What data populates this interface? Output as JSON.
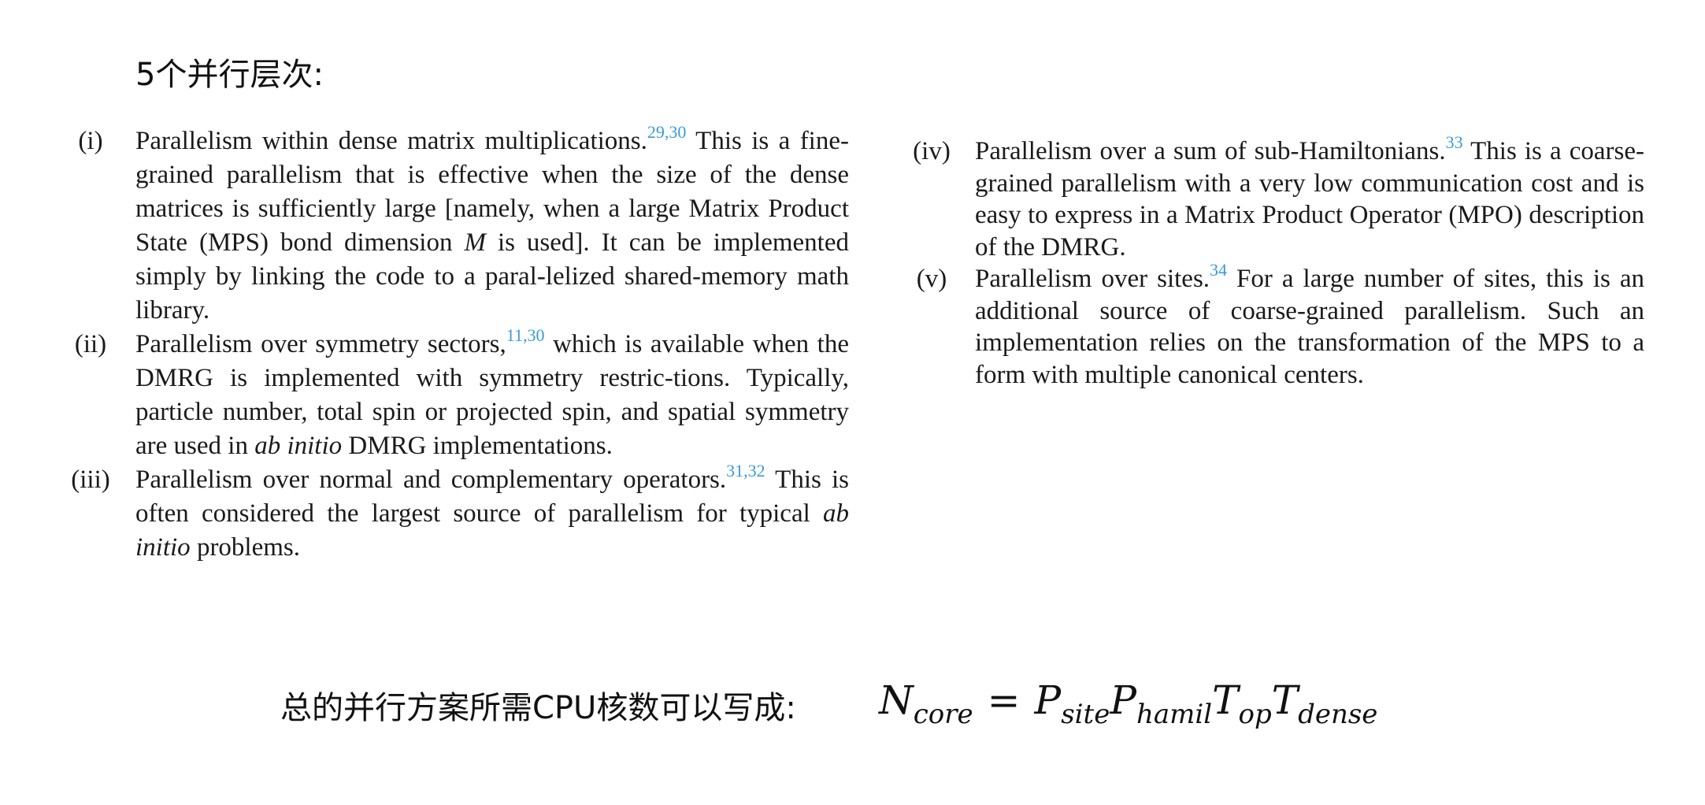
{
  "heading": "5个并行层次:",
  "left_items": [
    {
      "num": "(i)",
      "segments": [
        {
          "t": "Parallelism within dense matrix multiplications."
        },
        {
          "t": "29,30",
          "ref": true
        },
        {
          "t": " This is a fine-grained parallelism that is effective when the size of the dense matrices is sufficiently large [namely, when a large Matrix Product State (MPS) bond dimension "
        },
        {
          "t": "M",
          "it": true
        },
        {
          "t": " is used]. It can be implemented simply by linking the code to a paral-lelized shared-memory math library."
        }
      ]
    },
    {
      "num": "(ii)",
      "segments": [
        {
          "t": "Parallelism over symmetry sectors,"
        },
        {
          "t": "11,30",
          "ref": true
        },
        {
          "t": " which is available when the DMRG is implemented with symmetry restric-tions. Typically, particle number, total spin or projected spin, and spatial symmetry are used in "
        },
        {
          "t": "ab initio",
          "it": true
        },
        {
          "t": " DMRG implementations."
        }
      ]
    },
    {
      "num": "(iii)",
      "segments": [
        {
          "t": "Parallelism over normal and complementary operators."
        },
        {
          "t": "31,32",
          "ref": true
        },
        {
          "t": " This is often considered the largest source of parallelism for typical "
        },
        {
          "t": "ab initio",
          "it": true
        },
        {
          "t": " problems."
        }
      ]
    }
  ],
  "right_items": [
    {
      "num": "(iv)",
      "segments": [
        {
          "t": "Parallelism over a sum of sub-Hamiltonians."
        },
        {
          "t": "33",
          "ref": true
        },
        {
          "t": " This is a coarse-grained parallelism with a very low communication cost and is easy to express in a Matrix Product Operator (MPO) description of the DMRG."
        }
      ]
    },
    {
      "num": "(v)",
      "segments": [
        {
          "t": "Parallelism over sites."
        },
        {
          "t": "34",
          "ref": true
        },
        {
          "t": " For a large number of sites, this is an additional source of coarse-grained parallelism. Such an implementation relies on the transformation of the MPS to a form with multiple canonical centers."
        }
      ]
    }
  ],
  "formula_label": "总的并行方案所需CPU核数可以写成:",
  "formula": {
    "lhs": {
      "v": "N",
      "sub": "core"
    },
    "eq": "=",
    "rhs": [
      {
        "v": "P",
        "sub": "site"
      },
      {
        "v": "P",
        "sub": "hamil"
      },
      {
        "v": "T",
        "sub": "op"
      },
      {
        "v": "T",
        "sub": "dense"
      }
    ]
  },
  "ref_color": "#3a9ad9"
}
